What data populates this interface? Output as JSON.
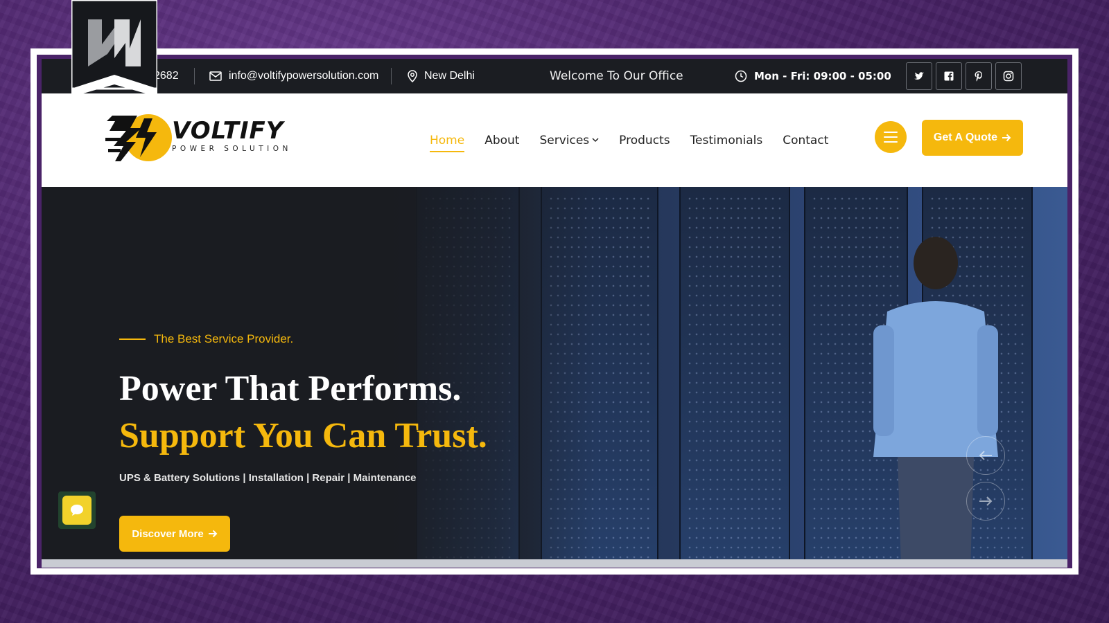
{
  "topbar": {
    "phone_partial": "2682",
    "email": "info@voltifypowersolution.com",
    "location": "New Delhi",
    "welcome": "Welcome To Our Office",
    "hours": "Mon - Fri: 09:00 - 05:00",
    "socials": [
      "twitter-icon",
      "facebook-icon",
      "pinterest-icon",
      "instagram-icon"
    ]
  },
  "brand": {
    "name": "VOLTIFY",
    "tagline": "POWER SOLUTION"
  },
  "nav": {
    "items": [
      "Home",
      "About",
      "Services",
      "Products",
      "Testimonials",
      "Contact"
    ],
    "active": "Home",
    "quote_label": "Get A Quote"
  },
  "hero": {
    "tag": "The Best Service Provider.",
    "headline_1": "Power That Performs.",
    "headline_2": "Support You Can Trust.",
    "subline": "UPS & Battery Solutions | Installation | Repair | Maintenance",
    "cta_label": "Discover More"
  },
  "colors": {
    "accent": "#f5b80d",
    "topbar_bg": "#1b1d22",
    "hero_bg": "#1a1c21"
  }
}
